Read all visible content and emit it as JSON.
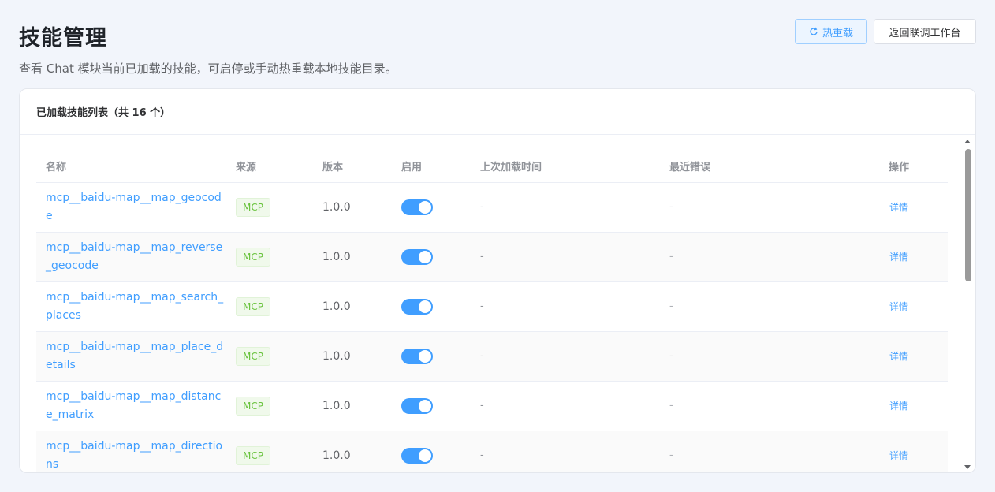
{
  "header": {
    "title": "技能管理",
    "subtitle": "查看 Chat 模块当前已加载的技能，可启停或手动热重载本地技能目录。",
    "reload_button": "热重载",
    "back_button": "返回联调工作台"
  },
  "card": {
    "title": "已加载技能列表（共 16 个）"
  },
  "table": {
    "columns": {
      "name": "名称",
      "source": "来源",
      "version": "版本",
      "enabled": "启用",
      "last_loaded": "上次加载时间",
      "last_error": "最近错误",
      "actions": "操作"
    },
    "rows": [
      {
        "name": "mcp__baidu-map__map_geocode",
        "source": "MCP",
        "version": "1.0.0",
        "enabled": true,
        "last_loaded": "-",
        "last_error": "-",
        "action": "详情"
      },
      {
        "name": "mcp__baidu-map__map_reverse_geocode",
        "source": "MCP",
        "version": "1.0.0",
        "enabled": true,
        "last_loaded": "-",
        "last_error": "-",
        "action": "详情"
      },
      {
        "name": "mcp__baidu-map__map_search_places",
        "source": "MCP",
        "version": "1.0.0",
        "enabled": true,
        "last_loaded": "-",
        "last_error": "-",
        "action": "详情"
      },
      {
        "name": "mcp__baidu-map__map_place_details",
        "source": "MCP",
        "version": "1.0.0",
        "enabled": true,
        "last_loaded": "-",
        "last_error": "-",
        "action": "详情"
      },
      {
        "name": "mcp__baidu-map__map_distance_matrix",
        "source": "MCP",
        "version": "1.0.0",
        "enabled": true,
        "last_loaded": "-",
        "last_error": "-",
        "action": "详情"
      },
      {
        "name": "mcp__baidu-map__map_directions",
        "source": "MCP",
        "version": "1.0.0",
        "enabled": true,
        "last_loaded": "-",
        "last_error": "-",
        "action": "详情"
      }
    ]
  },
  "icons": {
    "reload": "refresh-icon"
  },
  "colors": {
    "primary": "#409eff",
    "tag_green": "#67c23a",
    "background": "#f2f5fb"
  }
}
